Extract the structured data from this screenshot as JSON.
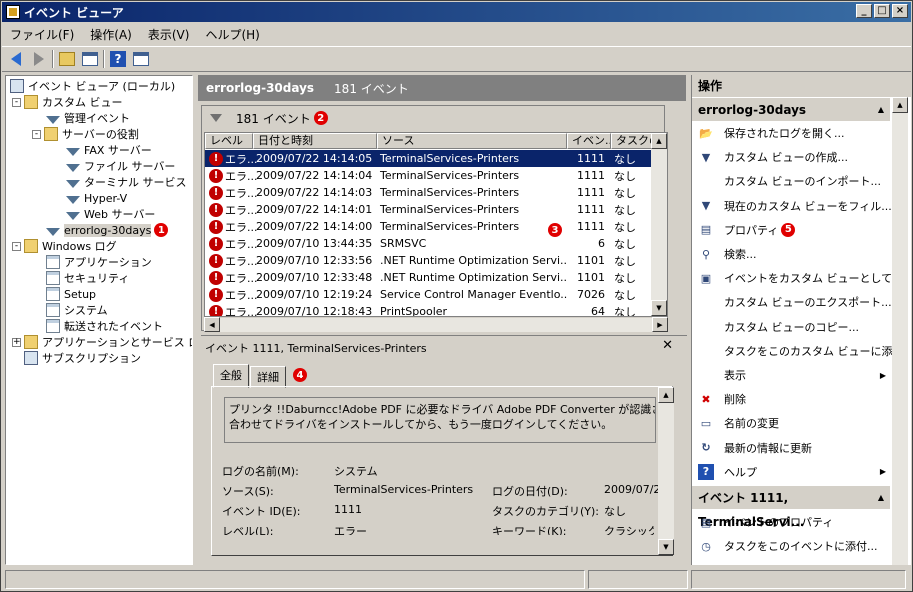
{
  "window": {
    "title": "イベント ビューア"
  },
  "menu": [
    "ファイル(F)",
    "操作(A)",
    "表示(V)",
    "ヘルプ(H)"
  ],
  "tree": {
    "root": "イベント ビューア (ローカル)",
    "custom_views": "カスタム ビュー",
    "admin_events": "管理イベント",
    "server_roles": "サーバーの役割",
    "fax": "FAX サーバー",
    "file": "ファイル サーバー",
    "terminal": "ターミナル サービス",
    "hyperv": "Hyper-V",
    "web": "Web サーバー",
    "errorlog": "errorlog-30days",
    "windows_log": "Windows ログ",
    "application": "アプリケーション",
    "security": "セキュリティ",
    "setup": "Setup",
    "system": "システム",
    "forwarded": "転送されたイベント",
    "apps_services": "アプリケーションとサービス ログ",
    "subscriptions": "サブスクリプション",
    "badge": "1"
  },
  "center": {
    "header_name": "errorlog-30days",
    "header_count": "181 イベント",
    "count_label": "181 イベント",
    "badge_count": "2",
    "badge_list": "3",
    "columns": [
      "レベル",
      "日付と時刻",
      "ソース",
      "イベン...",
      "タスクのカ..."
    ],
    "rows": [
      {
        "level": "エラ...",
        "date": "2009/07/22 14:14:05",
        "source": "TerminalServices-Printers",
        "id": "1111",
        "task": "なし"
      },
      {
        "level": "エラ...",
        "date": "2009/07/22 14:14:04",
        "source": "TerminalServices-Printers",
        "id": "1111",
        "task": "なし"
      },
      {
        "level": "エラ...",
        "date": "2009/07/22 14:14:03",
        "source": "TerminalServices-Printers",
        "id": "1111",
        "task": "なし"
      },
      {
        "level": "エラ...",
        "date": "2009/07/22 14:14:01",
        "source": "TerminalServices-Printers",
        "id": "1111",
        "task": "なし"
      },
      {
        "level": "エラ...",
        "date": "2009/07/22 14:14:00",
        "source": "TerminalServices-Printers",
        "id": "1111",
        "task": "なし"
      },
      {
        "level": "エラ...",
        "date": "2009/07/10 13:44:35",
        "source": "SRMSVC",
        "id": "6",
        "task": "なし"
      },
      {
        "level": "エラ...",
        "date": "2009/07/10 12:33:56",
        "source": ".NET Runtime Optimization Servi...",
        "id": "1101",
        "task": "なし"
      },
      {
        "level": "エラ...",
        "date": "2009/07/10 12:33:48",
        "source": ".NET Runtime Optimization Servi...",
        "id": "1101",
        "task": "なし"
      },
      {
        "level": "エラ...",
        "date": "2009/07/10 12:19:24",
        "source": "Service Control Manager Eventlo...",
        "id": "7026",
        "task": "なし"
      },
      {
        "level": "エラ...",
        "date": "2009/07/10 12:18:43",
        "source": "PrintSpooler",
        "id": "64",
        "task": "なし"
      }
    ]
  },
  "detail": {
    "title": "イベント 1111, TerminalServices-Printers",
    "close": "✕",
    "tab_general": "全般",
    "tab_details": "詳細",
    "badge": "4",
    "desc_line1": "プリンタ !!Daburncc!Adobe PDF に必要なドライバ Adobe PDF Converter が認識されませ",
    "desc_line2": "合わせてドライバをインストールしてから、もう一度ログインしてください。",
    "log_name_label": "ログの名前(M):",
    "log_name_value": "システム",
    "source_label": "ソース(S):",
    "source_value": "TerminalServices-Printers",
    "logdate_label": "ログの日付(D):",
    "logdate_value": "2009/07/2",
    "eventid_label": "イベント ID(E):",
    "eventid_value": "1111",
    "taskcat_label": "タスクのカテゴリ(Y):",
    "taskcat_value": "なし",
    "level_label": "レベル(L):",
    "level_value": "エラー",
    "keyword_label": "キーワード(K):",
    "keyword_value": "クラシック"
  },
  "actions": {
    "header": "操作",
    "section1": "errorlog-30days",
    "items1": [
      "保存されたログを開く...",
      "カスタム ビューの作成...",
      "カスタム ビューのインポート...",
      "現在のカスタム ビューをフィル...",
      "プロパティ",
      "検索...",
      "イベントをカスタム ビューとして...",
      "カスタム ビューのエクスポート...",
      "カスタム ビューのコピー...",
      "タスクをこのカスタム ビューに添...",
      "表示",
      "削除",
      "名前の変更",
      "最新の情報に更新",
      "ヘルプ"
    ],
    "badge": "5",
    "section2": "イベント 1111, TerminalServi...",
    "items2": [
      "イベントのプロパティ",
      "タスクをこのイベントに添付..."
    ]
  }
}
